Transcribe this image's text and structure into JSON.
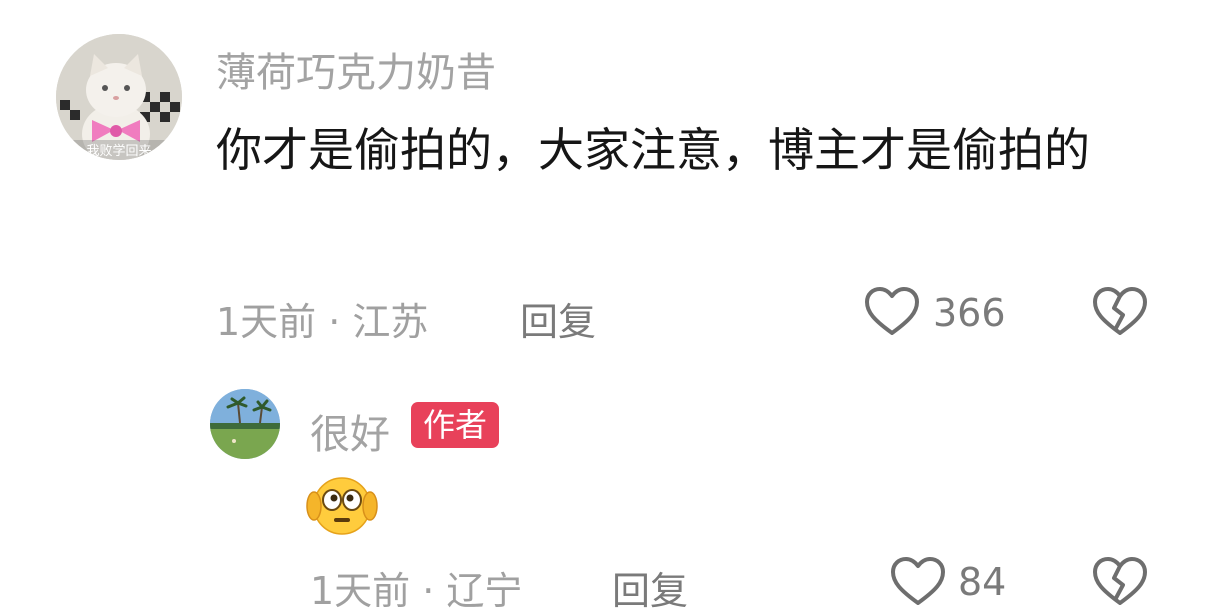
{
  "comment": {
    "username": "薄荷巧克力奶昔",
    "avatar_overlay_text": "我败学回来",
    "text": "你才是偷拍的，大家注意，博主才是偷拍的",
    "meta": "1天前 · 江苏",
    "reply_label": "回复",
    "like_count": "366",
    "like_icon": "heart-outline-icon",
    "dislike_icon": "broken-heart-icon"
  },
  "reply": {
    "username": "很好",
    "badge": "作者",
    "emoji": "face-with-hands-over-ears-emoji",
    "meta": "1天前 · 辽宁",
    "reply_label": "回复",
    "like_count": "84",
    "like_icon": "heart-outline-icon",
    "dislike_icon": "broken-heart-icon"
  },
  "colors": {
    "badge_bg": "#e8415a",
    "username": "#a3a3a3",
    "comment_text": "#161616"
  }
}
